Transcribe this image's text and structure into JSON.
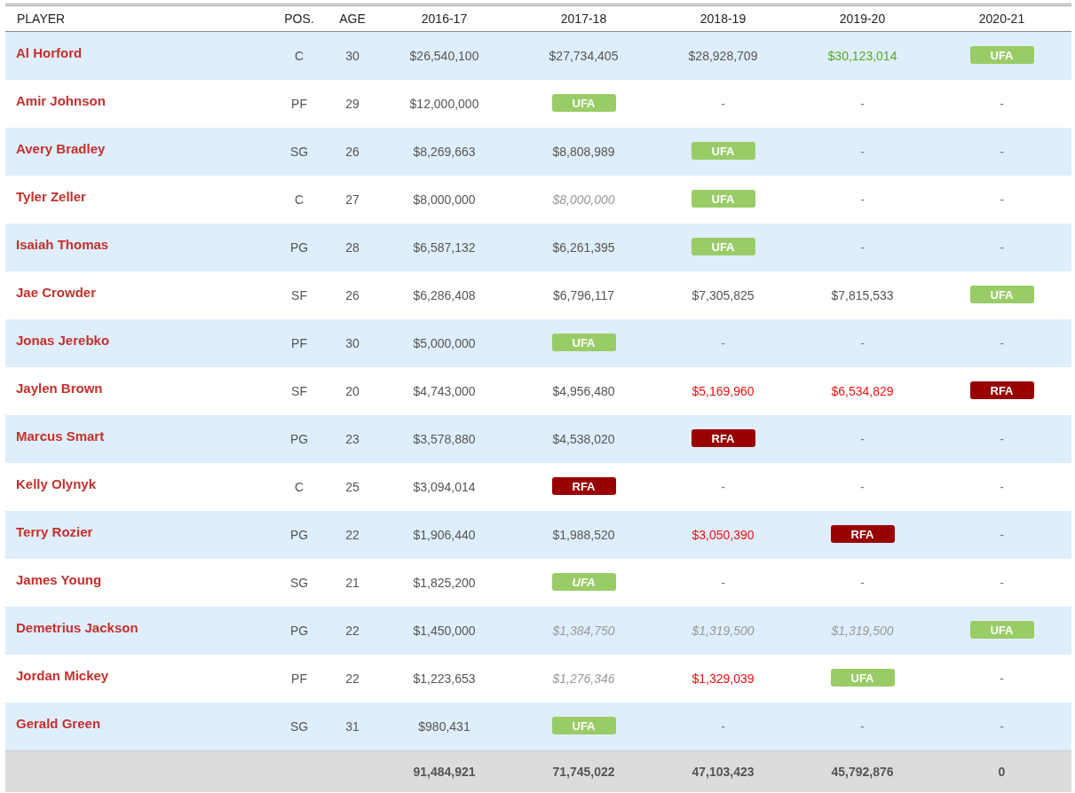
{
  "columns": [
    "PLAYER",
    "POS.",
    "AGE",
    "2016-17",
    "2017-18",
    "2018-19",
    "2019-20",
    "2020-21"
  ],
  "rows": [
    {
      "player": "Al Horford",
      "pos": "C",
      "age": "30",
      "cells": [
        {
          "kind": "amount",
          "text": "$26,540,100"
        },
        {
          "kind": "amount",
          "text": "$27,734,405"
        },
        {
          "kind": "amount",
          "text": "$28,928,709"
        },
        {
          "kind": "player_option",
          "text": "$30,123,014"
        },
        {
          "kind": "ufa",
          "text": "UFA",
          "italic": false
        }
      ]
    },
    {
      "player": "Amir Johnson",
      "pos": "PF",
      "age": "29",
      "cells": [
        {
          "kind": "amount",
          "text": "$12,000,000"
        },
        {
          "kind": "ufa",
          "text": "UFA",
          "italic": false
        },
        {
          "kind": "dash",
          "text": "-"
        },
        {
          "kind": "dash",
          "text": "-"
        },
        {
          "kind": "dash",
          "text": "-"
        }
      ]
    },
    {
      "player": "Avery Bradley",
      "pos": "SG",
      "age": "26",
      "cells": [
        {
          "kind": "amount",
          "text": "$8,269,663"
        },
        {
          "kind": "amount",
          "text": "$8,808,989"
        },
        {
          "kind": "ufa",
          "text": "UFA",
          "italic": false
        },
        {
          "kind": "dash",
          "text": "-"
        },
        {
          "kind": "dash",
          "text": "-"
        }
      ]
    },
    {
      "player": "Tyler Zeller",
      "pos": "C",
      "age": "27",
      "cells": [
        {
          "kind": "amount",
          "text": "$8,000,000"
        },
        {
          "kind": "non_guaranteed",
          "text": "$8,000,000"
        },
        {
          "kind": "ufa",
          "text": "UFA",
          "italic": false
        },
        {
          "kind": "dash",
          "text": "-"
        },
        {
          "kind": "dash",
          "text": "-"
        }
      ]
    },
    {
      "player": "Isaiah Thomas",
      "pos": "PG",
      "age": "28",
      "cells": [
        {
          "kind": "amount",
          "text": "$6,587,132"
        },
        {
          "kind": "amount",
          "text": "$6,261,395"
        },
        {
          "kind": "ufa",
          "text": "UFA",
          "italic": false
        },
        {
          "kind": "dash",
          "text": "-"
        },
        {
          "kind": "dash",
          "text": "-"
        }
      ]
    },
    {
      "player": "Jae Crowder",
      "pos": "SF",
      "age": "26",
      "cells": [
        {
          "kind": "amount",
          "text": "$6,286,408"
        },
        {
          "kind": "amount",
          "text": "$6,796,117"
        },
        {
          "kind": "amount",
          "text": "$7,305,825"
        },
        {
          "kind": "amount",
          "text": "$7,815,533"
        },
        {
          "kind": "ufa",
          "text": "UFA",
          "italic": false
        }
      ]
    },
    {
      "player": "Jonas Jerebko",
      "pos": "PF",
      "age": "30",
      "cells": [
        {
          "kind": "amount",
          "text": "$5,000,000"
        },
        {
          "kind": "ufa",
          "text": "UFA",
          "italic": false
        },
        {
          "kind": "dash",
          "text": "-"
        },
        {
          "kind": "dash",
          "text": "-"
        },
        {
          "kind": "dash",
          "text": "-"
        }
      ]
    },
    {
      "player": "Jaylen Brown",
      "pos": "SF",
      "age": "20",
      "cells": [
        {
          "kind": "amount",
          "text": "$4,743,000"
        },
        {
          "kind": "amount",
          "text": "$4,956,480"
        },
        {
          "kind": "team_option",
          "text": "$5,169,960"
        },
        {
          "kind": "team_option",
          "text": "$6,534,829"
        },
        {
          "kind": "rfa",
          "text": "RFA",
          "italic": false
        }
      ]
    },
    {
      "player": "Marcus Smart",
      "pos": "PG",
      "age": "23",
      "cells": [
        {
          "kind": "amount",
          "text": "$3,578,880"
        },
        {
          "kind": "amount",
          "text": "$4,538,020"
        },
        {
          "kind": "rfa",
          "text": "RFA",
          "italic": false
        },
        {
          "kind": "dash",
          "text": "-"
        },
        {
          "kind": "dash",
          "text": "-"
        }
      ]
    },
    {
      "player": "Kelly Olynyk",
      "pos": "C",
      "age": "25",
      "cells": [
        {
          "kind": "amount",
          "text": "$3,094,014"
        },
        {
          "kind": "rfa",
          "text": "RFA",
          "italic": false
        },
        {
          "kind": "dash",
          "text": "-"
        },
        {
          "kind": "dash",
          "text": "-"
        },
        {
          "kind": "dash",
          "text": "-"
        }
      ]
    },
    {
      "player": "Terry Rozier",
      "pos": "PG",
      "age": "22",
      "cells": [
        {
          "kind": "amount",
          "text": "$1,906,440"
        },
        {
          "kind": "amount",
          "text": "$1,988,520"
        },
        {
          "kind": "team_option",
          "text": "$3,050,390"
        },
        {
          "kind": "rfa",
          "text": "RFA",
          "italic": false
        },
        {
          "kind": "dash",
          "text": "-"
        }
      ]
    },
    {
      "player": "James Young",
      "pos": "SG",
      "age": "21",
      "cells": [
        {
          "kind": "amount",
          "text": "$1,825,200"
        },
        {
          "kind": "ufa",
          "text": "UFA",
          "italic": true
        },
        {
          "kind": "dash",
          "text": "-"
        },
        {
          "kind": "dash",
          "text": "-"
        },
        {
          "kind": "dash",
          "text": "-"
        }
      ]
    },
    {
      "player": "Demetrius Jackson",
      "pos": "PG",
      "age": "22",
      "cells": [
        {
          "kind": "amount",
          "text": "$1,450,000"
        },
        {
          "kind": "non_guaranteed",
          "text": "$1,384,750"
        },
        {
          "kind": "non_guaranteed",
          "text": "$1,319,500"
        },
        {
          "kind": "non_guaranteed",
          "text": "$1,319,500"
        },
        {
          "kind": "ufa",
          "text": "UFA",
          "italic": false
        }
      ]
    },
    {
      "player": "Jordan Mickey",
      "pos": "PF",
      "age": "22",
      "cells": [
        {
          "kind": "amount",
          "text": "$1,223,653"
        },
        {
          "kind": "non_guaranteed",
          "text": "$1,276,346"
        },
        {
          "kind": "team_option",
          "text": "$1,329,039"
        },
        {
          "kind": "ufa",
          "text": "UFA",
          "italic": false
        },
        {
          "kind": "dash",
          "text": "-"
        }
      ]
    },
    {
      "player": "Gerald Green",
      "pos": "SG",
      "age": "31",
      "cells": [
        {
          "kind": "amount",
          "text": "$980,431"
        },
        {
          "kind": "ufa",
          "text": "UFA",
          "italic": false
        },
        {
          "kind": "dash",
          "text": "-"
        },
        {
          "kind": "dash",
          "text": "-"
        },
        {
          "kind": "dash",
          "text": "-"
        }
      ]
    }
  ],
  "totals": [
    "91,484,921",
    "71,745,022",
    "47,103,423",
    "45,792,876",
    "0"
  ]
}
